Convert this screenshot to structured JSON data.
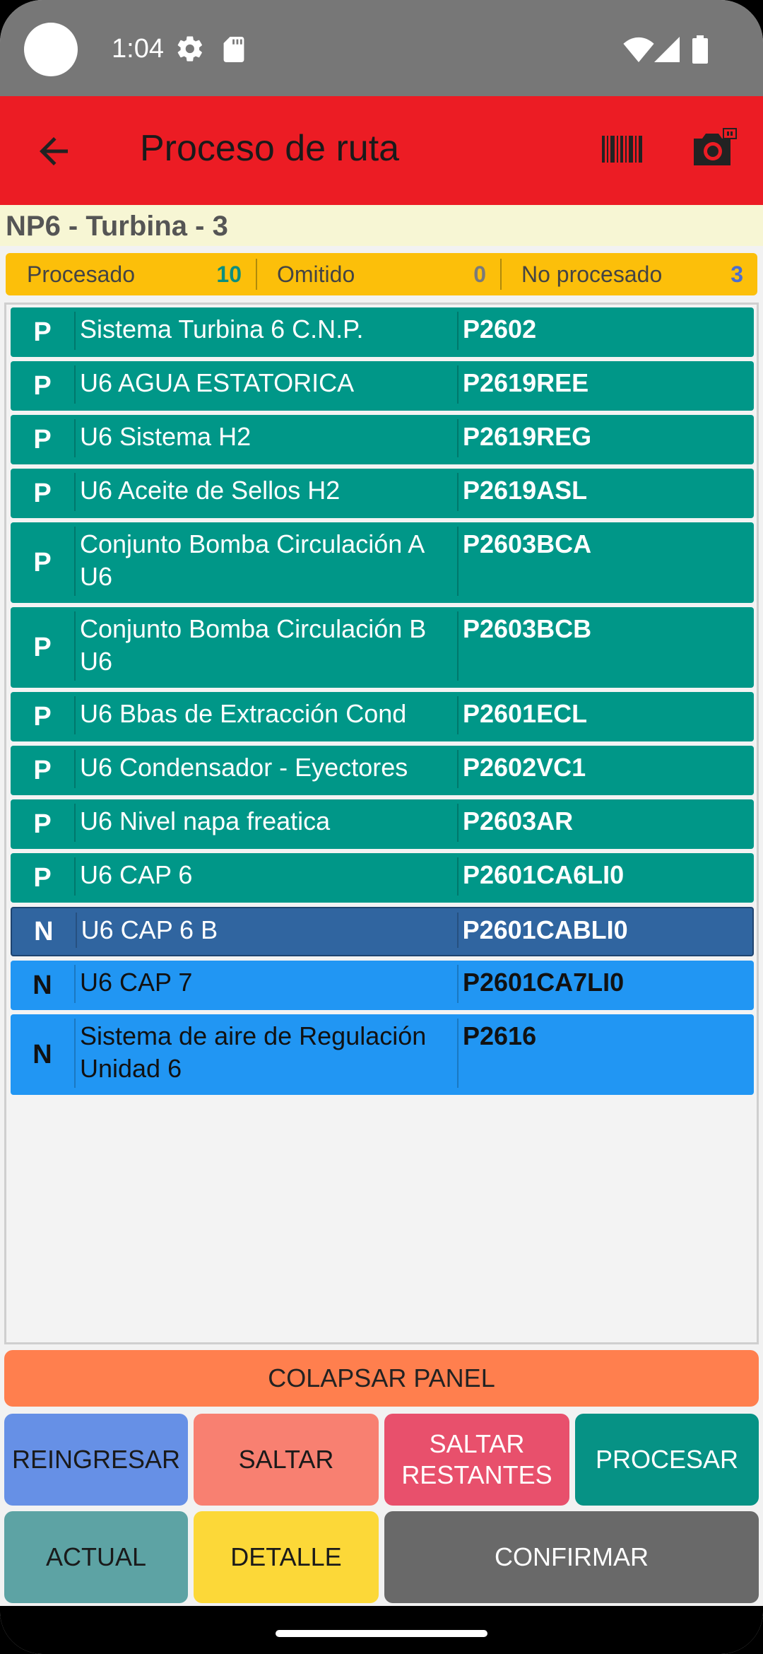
{
  "status_bar": {
    "time": "1:04",
    "icons": [
      "settings-icon",
      "sd-card-icon",
      "wifi-icon",
      "signal-icon",
      "battery-icon"
    ]
  },
  "app_bar": {
    "title": "Proceso de ruta",
    "color": "#ec1c24",
    "icons": [
      "back-arrow-icon",
      "barcode-icon",
      "camera-icon"
    ]
  },
  "route": {
    "title": "NP6 - Turbina - 3"
  },
  "summary": {
    "processed_label": "Procesado",
    "processed_value": "10",
    "processed_color": "#0b8f7e",
    "omitted_label": "Omitido",
    "omitted_value": "0",
    "omitted_color": "#7a7a7a",
    "not_processed_label": "No procesado",
    "not_processed_value": "3",
    "not_processed_color": "#4b6ed0"
  },
  "list": {
    "items": [
      {
        "status": "P",
        "name": "Sistema Turbina 6 C.N.P.",
        "code": "P2602"
      },
      {
        "status": "P",
        "name": "U6 AGUA ESTATORICA",
        "code": "P2619REE"
      },
      {
        "status": "P",
        "name": "U6 Sistema H2",
        "code": "P2619REG"
      },
      {
        "status": "P",
        "name": "U6 Aceite de Sellos H2",
        "code": "P2619ASL"
      },
      {
        "status": "P",
        "name": "Conjunto Bomba Circulación A U6",
        "code": "P2603BCA"
      },
      {
        "status": "P",
        "name": "Conjunto Bomba Circulación B U6",
        "code": "P2603BCB"
      },
      {
        "status": "P",
        "name": "U6 Bbas de Extracción Cond",
        "code": "P2601ECL"
      },
      {
        "status": "P",
        "name": "U6 Condensador - Eyectores",
        "code": "P2602VC1"
      },
      {
        "status": "P",
        "name": "U6 Nivel napa freatica",
        "code": "P2603AR"
      },
      {
        "status": "P",
        "name": "U6 CAP 6",
        "code": "P2601CA6LI0"
      },
      {
        "status": "N",
        "name": "U6 CAP 6 B",
        "code": "P2601CABLI0"
      },
      {
        "status": "N",
        "name": "U6 CAP 7",
        "code": "P2601CA7LI0"
      },
      {
        "status": "N",
        "name": "Sistema de aire de Regulación Unidad 6",
        "code": "P2616"
      }
    ],
    "selected_index": 10
  },
  "buttons": {
    "collapse": "COLAPSAR PANEL",
    "reingresar": "REINGRESAR",
    "saltar": "SALTAR",
    "saltar_restantes": "SALTAR RESTANTES",
    "procesar": "PROCESAR",
    "actual": "ACTUAL",
    "detalle": "DETALLE",
    "confirmar": "CONFIRMAR"
  }
}
